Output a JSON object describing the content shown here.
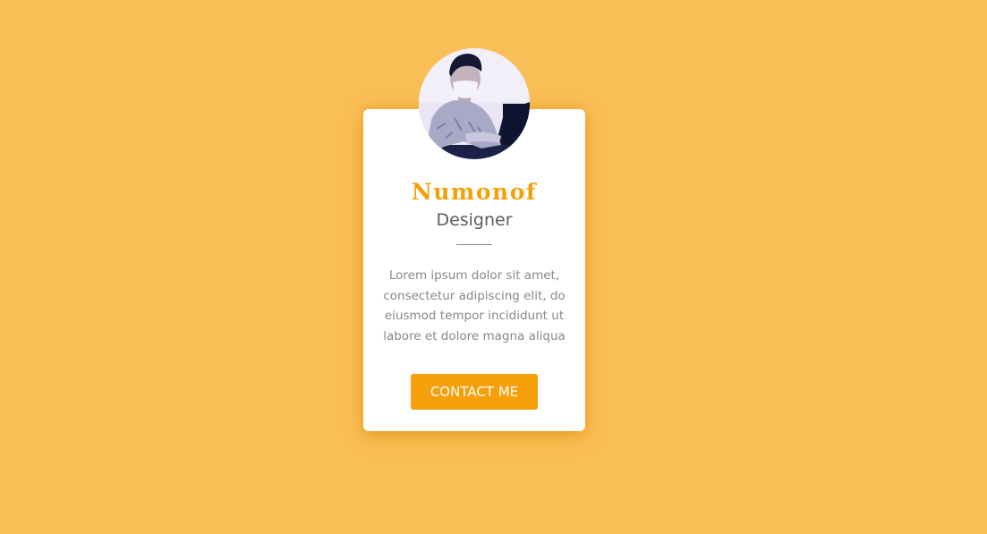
{
  "profile": {
    "name": "Numonof",
    "role": "Designer",
    "description": "Lorem ipsum dolor sit amet, consectetur adipiscing elit, do eiusmod tempor incididunt ut labore et dolore magna aliqua",
    "button_label": "CONTACT ME",
    "avatar": "person-with-face-mask-at-laptop-photo"
  },
  "colors": {
    "background": "#f9be56",
    "accent": "#f5a00a",
    "card": "#ffffff"
  }
}
